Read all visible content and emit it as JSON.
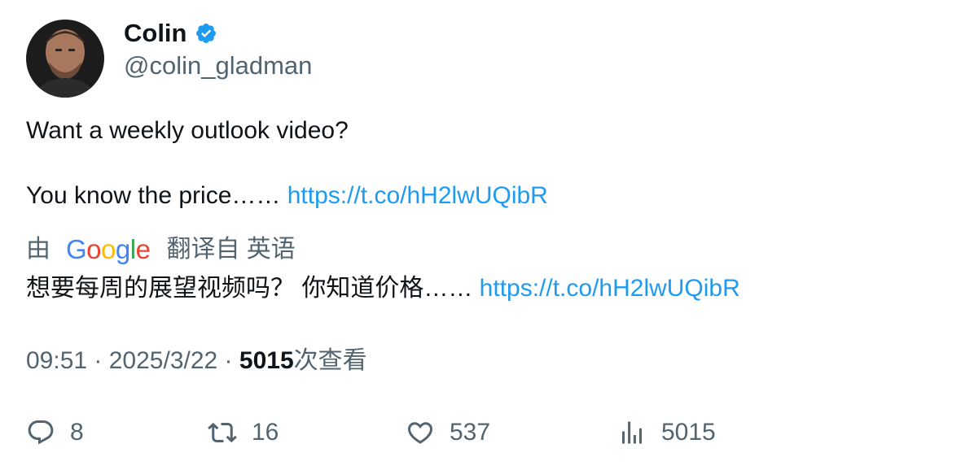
{
  "author": {
    "name": "Colin",
    "handle": "@colin_gladman",
    "verified_color": "#1d9bf0"
  },
  "tweet": {
    "line1": "Want a weekly outlook video?",
    "line2_text": "You know the price…… ",
    "line2_link": "https://t.co/hH2lwUQibR"
  },
  "translation": {
    "prefix": "由",
    "provider": "Google",
    "suffix": "翻译自 英语",
    "text": "想要每周的展望视频吗？ 你知道价格…… ",
    "link": "https://t.co/hH2lwUQibR"
  },
  "meta": {
    "time": "09:51",
    "date": "2025/3/22",
    "views_count": "5015",
    "views_label": "次查看",
    "separator": " · "
  },
  "actions": {
    "replies": "8",
    "retweets": "16",
    "likes": "537",
    "views": "5015"
  },
  "colors": {
    "text": "#0f1419",
    "secondary": "#536471",
    "link": "#1d9bf0"
  }
}
